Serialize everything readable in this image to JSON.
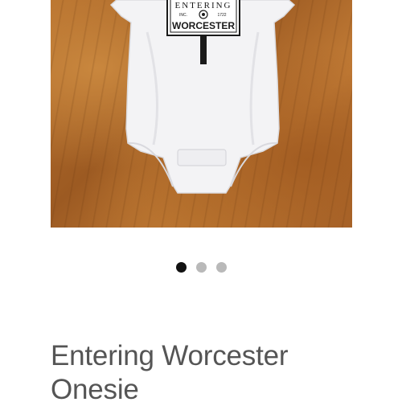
{
  "product": {
    "title": "Entering Worcester Onesie",
    "image_alt": "White baby onesie with Entering Worcester sign graphic on wood background",
    "print": {
      "top_text": "ENTERING",
      "inc_label": "INC.",
      "year": "1722",
      "city": "WORCESTER"
    }
  },
  "gallery": {
    "slides": [
      {
        "label": "Image 1",
        "active": true
      },
      {
        "label": "Image 2",
        "active": false
      },
      {
        "label": "Image 3",
        "active": false
      }
    ]
  },
  "colors": {
    "background": "#ffffff",
    "title_text": "#555555",
    "dot_active": "#111111",
    "dot_inactive": "#b9b9b9",
    "wood": "#a8642a"
  }
}
